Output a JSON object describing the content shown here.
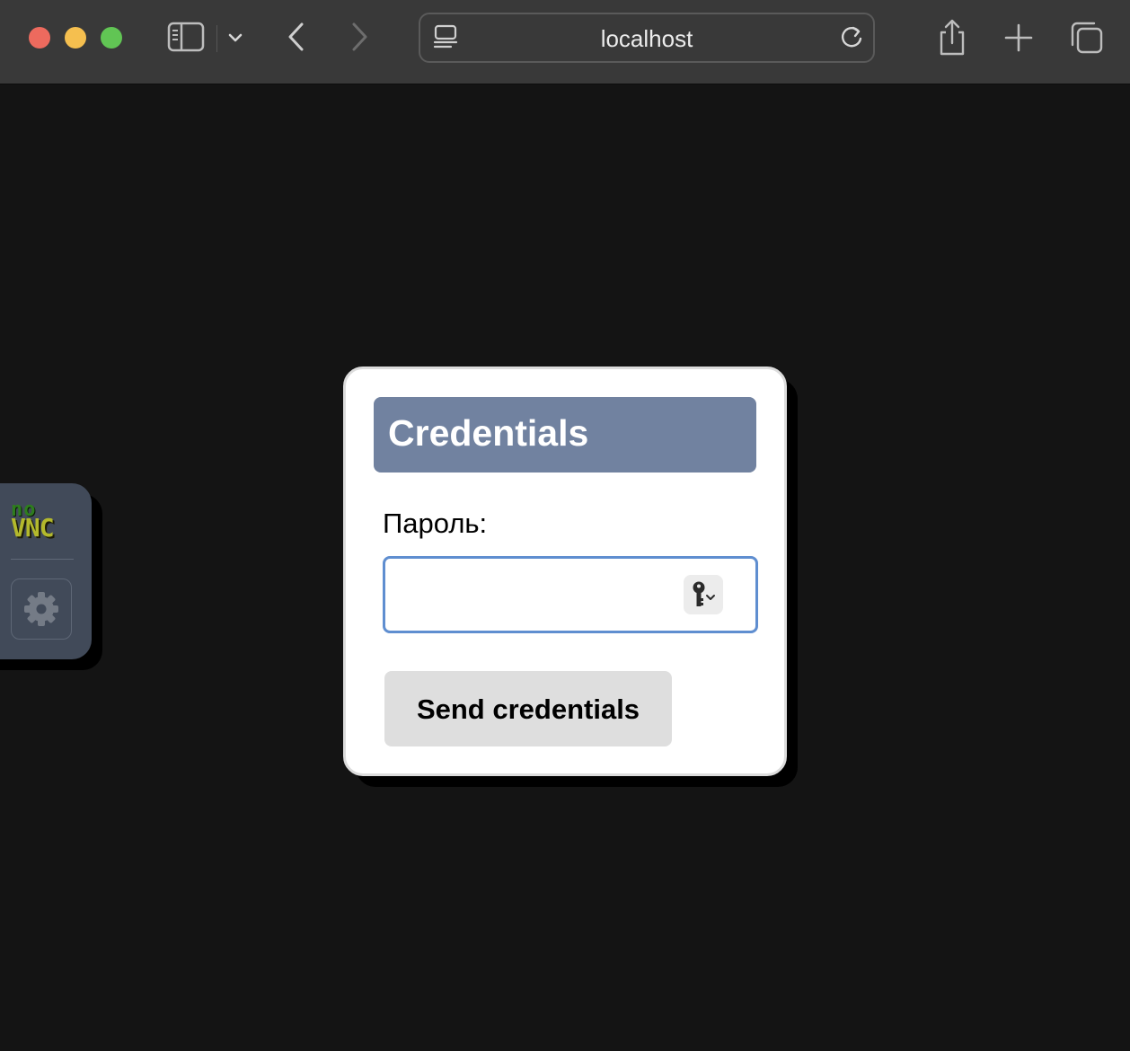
{
  "browser": {
    "url": "localhost",
    "icons": {
      "sidebar": "sidebar-icon",
      "tab_group": "chevron-down-icon",
      "back": "chevron-left-icon",
      "forward": "chevron-right-icon",
      "reader": "reader-icon",
      "reload": "reload-icon",
      "share": "share-icon",
      "new_tab": "plus-icon",
      "tab_overview": "tabs-icon"
    }
  },
  "vnc_bar": {
    "logo_no": "no",
    "logo_vnc": "VNC",
    "settings_icon": "gear-icon",
    "colors": {
      "background": "#414a59",
      "logo_no": "#2e7d1e",
      "logo_vnc": "#b3b92c"
    }
  },
  "dialog": {
    "title": "Credentials",
    "password_label": "Пароль:",
    "password_value": "",
    "password_autofill_icon": "key-icon",
    "submit_label": "Send credentials",
    "colors": {
      "header": "#7182a0",
      "input_focus": "#5f8ed0",
      "button": "#dedede"
    }
  }
}
